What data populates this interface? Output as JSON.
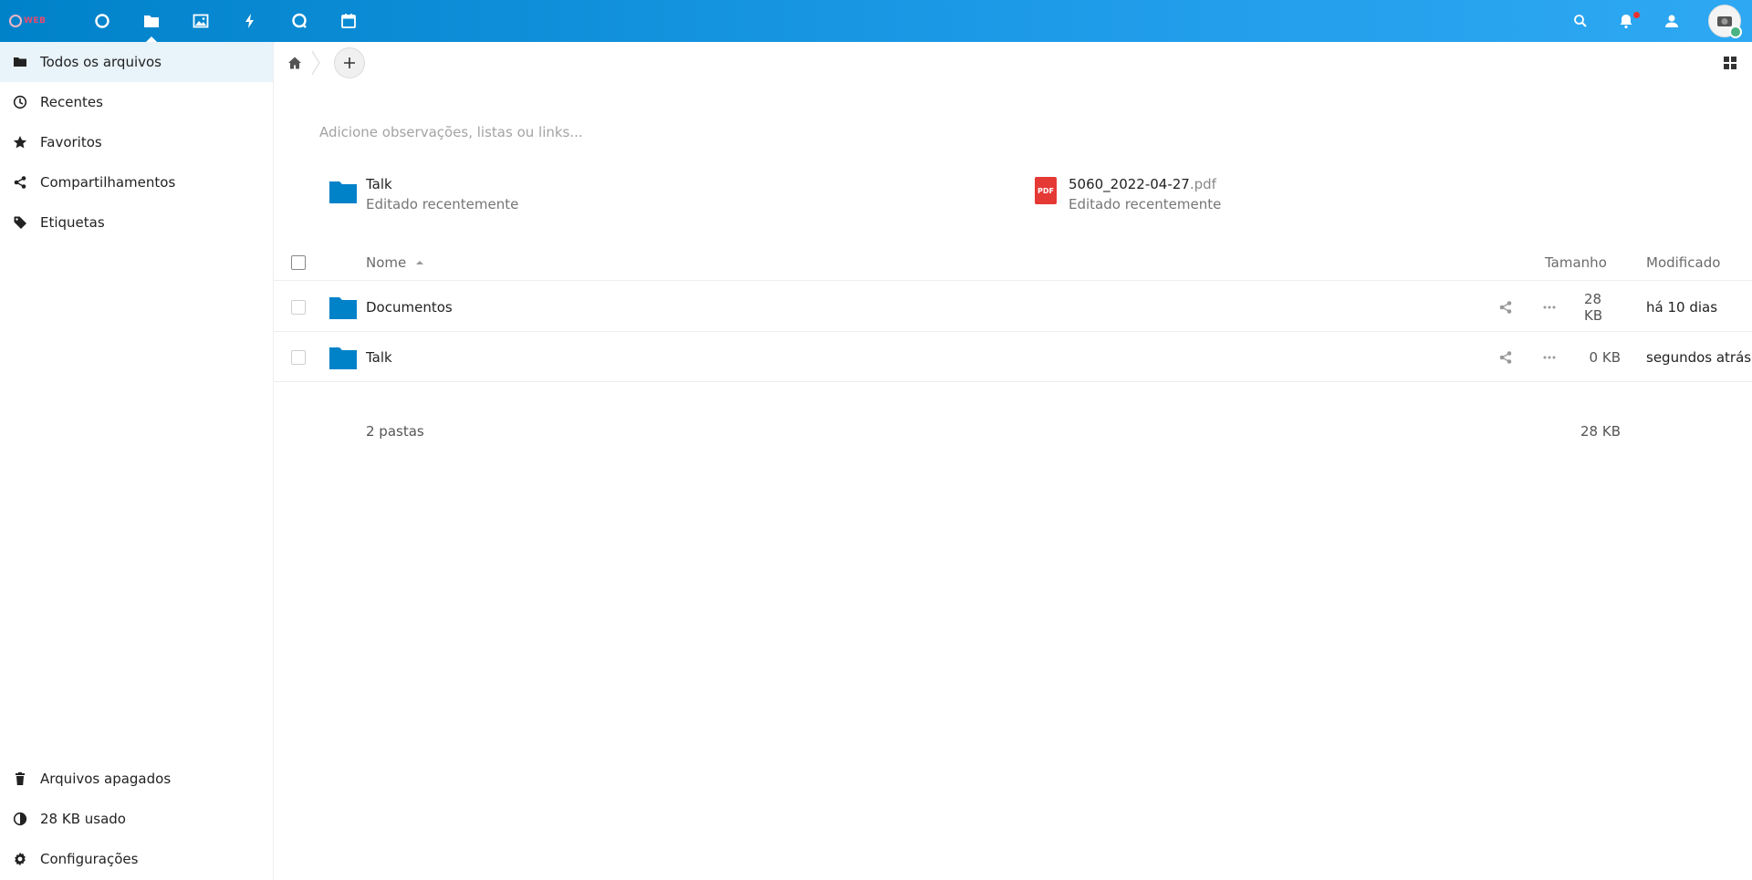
{
  "header": {
    "logo_text": "WEB",
    "apps": [
      {
        "name": "dashboard-icon"
      },
      {
        "name": "files-icon"
      },
      {
        "name": "photos-icon"
      },
      {
        "name": "activity-icon"
      },
      {
        "name": "talk-icon"
      },
      {
        "name": "calendar-icon"
      }
    ],
    "right_icons": [
      "search-icon",
      "notifications-icon",
      "contacts-icon"
    ],
    "accent": "#0082c9"
  },
  "sidebar": {
    "items": [
      {
        "label": "Todos os arquivos",
        "icon": "folder-icon"
      },
      {
        "label": "Recentes",
        "icon": "clock-icon"
      },
      {
        "label": "Favoritos",
        "icon": "star-icon"
      },
      {
        "label": "Compartilhamentos",
        "icon": "share-icon"
      },
      {
        "label": "Etiquetas",
        "icon": "tag-icon"
      }
    ],
    "bottom": [
      {
        "label": "Arquivos apagados",
        "icon": "trash-icon"
      },
      {
        "label": "28 KB usado",
        "icon": "quota-icon"
      },
      {
        "label": "Configurações",
        "icon": "gear-icon"
      }
    ]
  },
  "main": {
    "notes_placeholder": "Adicione observações, listas ou links...",
    "recent": [
      {
        "name": "Talk",
        "ext": "",
        "sub": "Editado recentemente",
        "type": "folder"
      },
      {
        "name": "5060_2022-04-27",
        "ext": ".pdf",
        "sub": "Editado recentemente",
        "type": "pdf",
        "badge": "PDF"
      }
    ],
    "table": {
      "col_name": "Nome",
      "col_size": "Tamanho",
      "col_modified": "Modificado",
      "rows": [
        {
          "name": "Documentos",
          "size": "28 KB",
          "modified": "há 10 dias"
        },
        {
          "name": "Talk",
          "size": "0 KB",
          "modified": "segundos atrás"
        }
      ],
      "summary_count": "2 pastas",
      "summary_size": "28 KB"
    }
  }
}
